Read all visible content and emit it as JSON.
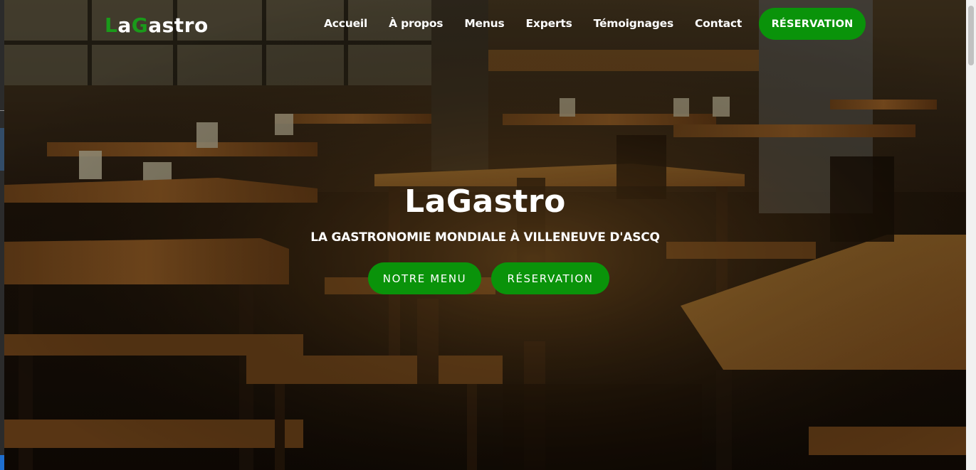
{
  "brand": {
    "logo_parts": [
      "L",
      "a",
      "G",
      "astro"
    ],
    "accent_color": "#1a9a1a"
  },
  "nav": {
    "items": [
      "Accueil",
      "À propos",
      "Menus",
      "Experts",
      "Témoignages",
      "Contact"
    ],
    "cta_label": "RÉSERVATION"
  },
  "hero": {
    "title": "LaGastro",
    "subtitle": "LA GASTRONOMIE MONDIALE À VILLENEUVE D'ASCQ",
    "primary_button": "NOTRE MENU",
    "secondary_button": "RÉSERVATION",
    "background_image": "restaurant-interior"
  },
  "colors": {
    "button_green": "#0a930a",
    "text": "#ffffff"
  }
}
